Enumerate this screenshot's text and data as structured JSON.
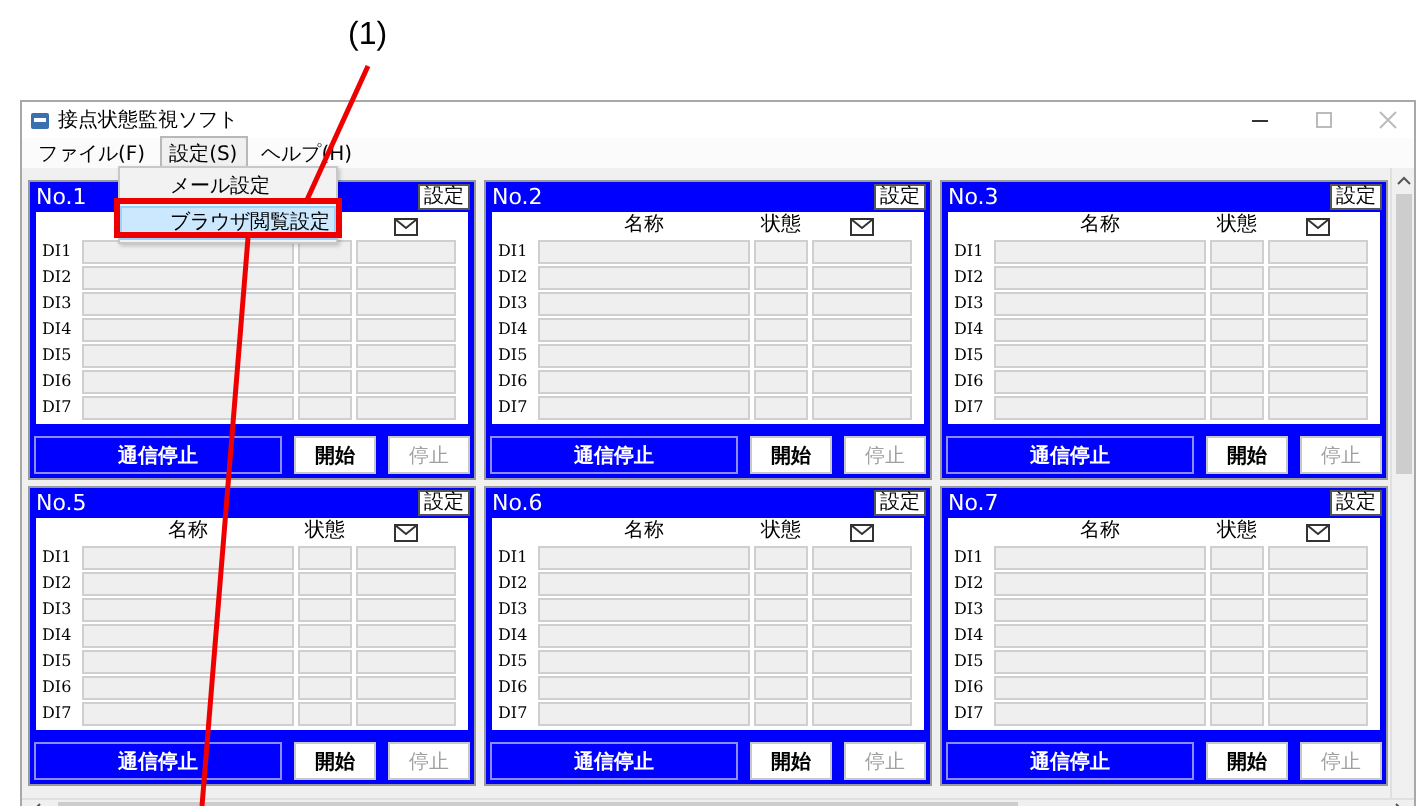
{
  "annotation": {
    "label": "(1)"
  },
  "window": {
    "title": "接点状態監視ソフト"
  },
  "menu": [
    {
      "label": "ファイル(F)",
      "selected": false
    },
    {
      "label": "設定(S)",
      "selected": true
    },
    {
      "label": "ヘルプ(H)",
      "selected": false
    }
  ],
  "dropdown": [
    {
      "label": "メール設定",
      "selected": false
    },
    {
      "label": "ブラウザ閲覧設定",
      "selected": true
    }
  ],
  "panels": [
    {
      "title": "No.1",
      "settings_button": "設定",
      "rows": [
        "DI1",
        "DI2",
        "DI3",
        "DI4",
        "DI5",
        "DI6",
        "DI7"
      ],
      "buttons": [
        {
          "kind": "primary",
          "label": "通信停止",
          "disabled": false
        },
        {
          "kind": "plain",
          "label": "開始",
          "disabled": false
        },
        {
          "kind": "plain",
          "label": "停止",
          "disabled": true
        }
      ]
    },
    {
      "title": "No.2",
      "settings_button": "設定",
      "columns": [
        "名称",
        "状態"
      ],
      "rows": [
        "DI1",
        "DI2",
        "DI3",
        "DI4",
        "DI5",
        "DI6",
        "DI7"
      ],
      "buttons": [
        {
          "kind": "primary",
          "label": "通信停止",
          "disabled": false
        },
        {
          "kind": "plain",
          "label": "開始",
          "disabled": false
        },
        {
          "kind": "plain",
          "label": "停止",
          "disabled": true
        }
      ]
    },
    {
      "title": "No.3",
      "settings_button": "設定",
      "columns": [
        "名称",
        "状態"
      ],
      "rows": [
        "DI1",
        "DI2",
        "DI3",
        "DI4",
        "DI5",
        "DI6",
        "DI7"
      ],
      "buttons": [
        {
          "kind": "primary",
          "label": "通信停止",
          "disabled": false
        },
        {
          "kind": "plain",
          "label": "開始",
          "disabled": false
        },
        {
          "kind": "plain",
          "label": "停止",
          "disabled": true
        }
      ]
    },
    {
      "title": "No.5",
      "settings_button": "設定",
      "columns": [
        "名称",
        "状態"
      ],
      "rows": [
        "DI1",
        "DI2",
        "DI3",
        "DI4",
        "DI5",
        "DI6",
        "DI7"
      ],
      "buttons": [
        {
          "kind": "primary",
          "label": "通信停止",
          "disabled": false
        },
        {
          "kind": "plain",
          "label": "開始",
          "disabled": false
        },
        {
          "kind": "plain",
          "label": "停止",
          "disabled": true
        }
      ]
    },
    {
      "title": "No.6",
      "settings_button": "設定",
      "columns": [
        "名称",
        "状態"
      ],
      "rows": [
        "DI1",
        "DI2",
        "DI3",
        "DI4",
        "DI5",
        "DI6",
        "DI7"
      ],
      "buttons": [
        {
          "kind": "primary",
          "label": "通信停止",
          "disabled": false
        },
        {
          "kind": "plain",
          "label": "開始",
          "disabled": false
        },
        {
          "kind": "plain",
          "label": "停止",
          "disabled": true
        }
      ]
    },
    {
      "title": "No.7",
      "settings_button": "設定",
      "columns": [
        "名称",
        "状態"
      ],
      "rows": [
        "DI1",
        "DI2",
        "DI3",
        "DI4",
        "DI5",
        "DI6",
        "DI7"
      ],
      "buttons": [
        {
          "kind": "primary",
          "label": "通信停止",
          "disabled": false
        },
        {
          "kind": "plain",
          "label": "開始",
          "disabled": false
        },
        {
          "kind": "plain",
          "label": "停止",
          "disabled": true
        }
      ]
    }
  ]
}
